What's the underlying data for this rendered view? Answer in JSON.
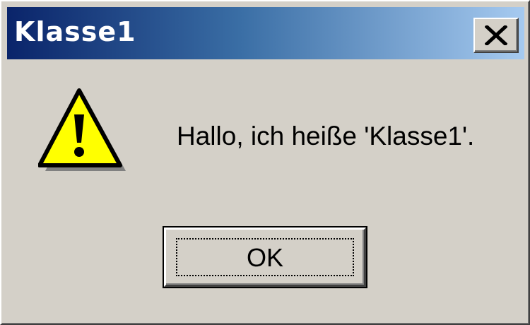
{
  "dialog": {
    "title": "Klasse1",
    "message": "Hallo, ich heiße 'Klasse1'.",
    "icon": "warning-icon",
    "buttons": {
      "ok_label": "OK",
      "close_icon": "close-icon"
    }
  },
  "colors": {
    "titlebar_start": "#0a246a",
    "titlebar_end": "#a6caf0",
    "face": "#d4d0c8",
    "warning_fill": "#ffff00"
  }
}
